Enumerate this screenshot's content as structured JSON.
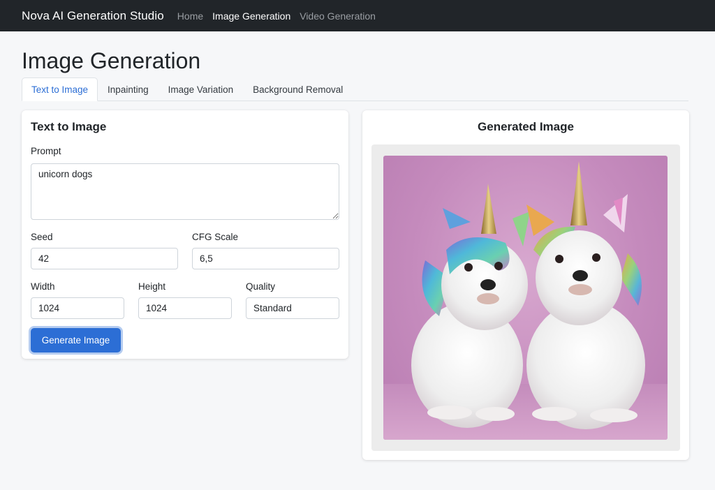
{
  "navbar": {
    "brand": "Nova AI Generation Studio",
    "links": [
      {
        "label": "Home",
        "active": false
      },
      {
        "label": "Image Generation",
        "active": true
      },
      {
        "label": "Video Generation",
        "active": false
      }
    ]
  },
  "page": {
    "title": "Image Generation"
  },
  "tabs": [
    {
      "label": "Text to Image",
      "active": true
    },
    {
      "label": "Inpainting",
      "active": false
    },
    {
      "label": "Image Variation",
      "active": false
    },
    {
      "label": "Background Removal",
      "active": false
    }
  ],
  "form": {
    "title": "Text to Image",
    "prompt_label": "Prompt",
    "prompt_value": "unicorn dogs",
    "seed_label": "Seed",
    "seed_value": "42",
    "cfg_label": "CFG Scale",
    "cfg_value": "6,5",
    "width_label": "Width",
    "width_value": "1024",
    "height_label": "Height",
    "height_value": "1024",
    "quality_label": "Quality",
    "quality_value": "Standard",
    "generate_label": "Generate Image"
  },
  "result": {
    "title": "Generated Image"
  },
  "colors": {
    "navbar": "#212529",
    "primary": "#2c6ed5",
    "image_background": "#c58bbd"
  }
}
